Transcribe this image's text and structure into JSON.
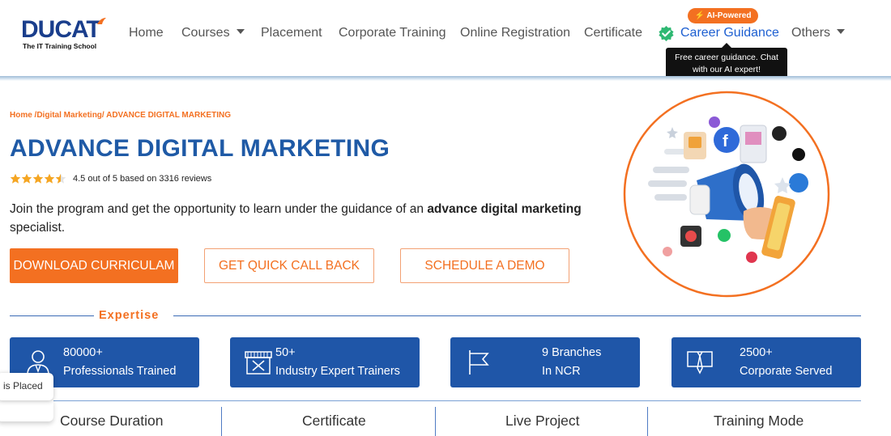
{
  "logo": {
    "name": "DUCAT",
    "tagline": "The IT Training School"
  },
  "nav": {
    "home": "Home",
    "courses": "Courses",
    "placement": "Placement",
    "corporate_training": "Corporate Training",
    "online_registration": "Online Registration",
    "certificate": "Certificate",
    "career_guidance": "Career Guidance",
    "others": "Others",
    "ai_badge": "⚡ AI-Powered",
    "tooltip": "Free career guidance. Chat with our AI expert!"
  },
  "hero": {
    "breadcrumb": "Home /Digital Marketing/ ADVANCE DIGITAL MARKETING",
    "title": "ADVANCE DIGITAL MARKETING",
    "rating_value": 4.5,
    "rating_text": "4.5 out of 5 based on 3316 reviews",
    "lead_prefix": "Join the program and get the opportunity to learn under the guidance of an ",
    "lead_bold": "advance digital marketing",
    "lead_suffix": " specialist.",
    "buttons": {
      "download": "DOWNLOAD CURRICULAM",
      "call_back": "GET QUICK CALL BACK",
      "demo": "SCHEDULE A DEMO"
    }
  },
  "expertise": {
    "label": "Expertise",
    "stats": [
      {
        "line1": "80000+",
        "line2": "Professionals Trained",
        "icon": "professional-icon"
      },
      {
        "line1": "50+",
        "line2": "Industry Expert Trainers",
        "icon": "trainer-icon"
      },
      {
        "line1": "9 Branches",
        "line2": "In NCR",
        "icon": "flag-icon"
      },
      {
        "line1": "2500+",
        "line2": "Corporate Served",
        "icon": "tie-icon"
      }
    ]
  },
  "tabs": [
    "Course Duration",
    "Certificate",
    "Live Project",
    "Training Mode"
  ],
  "toast": {
    "text": "is Placed"
  },
  "colors": {
    "brand_blue": "#1f56a8",
    "accent_orange": "#f37021",
    "link_blue": "#1d5fd1"
  }
}
